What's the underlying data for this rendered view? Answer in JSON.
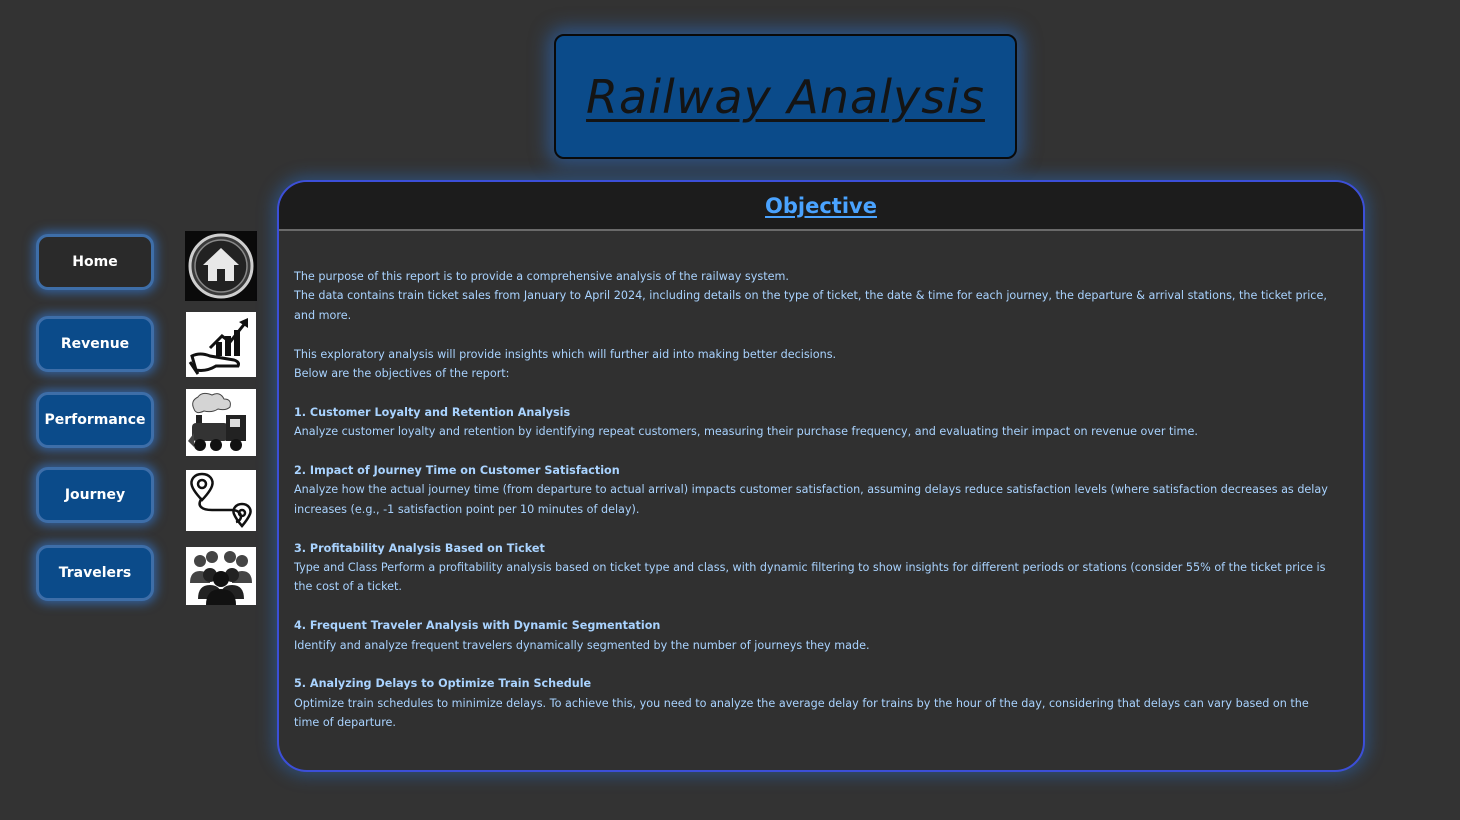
{
  "title": "Railway Analysis",
  "nav": {
    "items": [
      {
        "label": "Home",
        "icon": "home-icon"
      },
      {
        "label": "Revenue",
        "icon": "revenue-growth-icon"
      },
      {
        "label": "Performance",
        "icon": "steam-train-icon"
      },
      {
        "label": "Journey",
        "icon": "route-pins-icon"
      },
      {
        "label": "Travelers",
        "icon": "people-group-icon"
      }
    ]
  },
  "panel": {
    "heading": "Objective",
    "intro": [
      "The purpose of this report is to provide a comprehensive analysis of the railway system.",
      "The data contains train ticket sales from January to April 2024, including details on the type of ticket, the date & time for each journey, the departure & arrival stations, the ticket price, and more."
    ],
    "lead": [
      "This exploratory analysis will provide insights which will further aid into making better decisions.",
      "Below are the objectives of the report:"
    ],
    "objectives": [
      {
        "title": "1. Customer Loyalty and Retention Analysis",
        "text": "Analyze customer loyalty and retention by identifying repeat customers, measuring their purchase frequency, and evaluating their impact on revenue over time."
      },
      {
        "title": "2. Impact of Journey Time on Customer Satisfaction",
        "text": "Analyze how the actual journey time (from departure to actual arrival) impacts customer satisfaction, assuming delays reduce satisfaction levels (where satisfaction decreases as delay increases (e.g., -1 satisfaction point per 10 minutes of delay)."
      },
      {
        "title": "3. Profitability Analysis Based on Ticket",
        "text": "Type and Class Perform a profitability analysis based on ticket type and class, with dynamic filtering to show insights for different periods or stations (consider 55% of the ticket price is the cost of a ticket."
      },
      {
        "title": "4. Frequent Traveler Analysis with Dynamic Segmentation",
        "text": "Identify and analyze frequent travelers dynamically segmented by the number of journeys they made."
      },
      {
        "title": "5. Analyzing Delays to Optimize Train Schedule",
        "text": "Optimize train schedules to minimize delays. To achieve this, you need to analyze the average delay for trains by the hour of the day, considering that delays can vary based on the time of departure."
      }
    ]
  },
  "colors": {
    "background": "#333333",
    "title_box": "#0b4b8a",
    "accent_blue": "#4aa3ff",
    "body_text": "#a9d3ff",
    "panel_border": "#3c4fd8"
  }
}
